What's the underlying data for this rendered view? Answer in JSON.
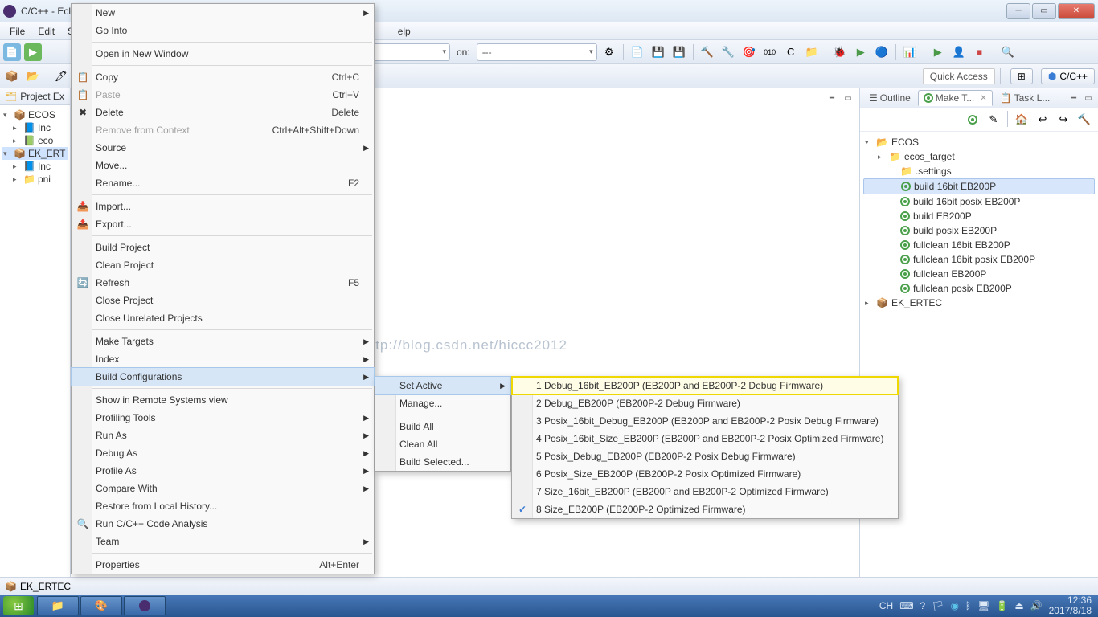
{
  "titlebar": {
    "title": "C/C++ - Ecl"
  },
  "menubar": {
    "items": [
      "File",
      "Edit",
      "So",
      "elp"
    ]
  },
  "toolbar1": {
    "on_label": "on:",
    "on_value": "---"
  },
  "toolbar2": {
    "quick_access": "Quick Access",
    "perspective": "C/C++"
  },
  "project_explorer": {
    "title": "Project Ex",
    "tree": [
      {
        "label": "ECOS",
        "expanded": true,
        "icon": "project"
      },
      {
        "label": "Inc",
        "indent": 1,
        "icon": "h"
      },
      {
        "label": "eco",
        "indent": 1,
        "icon": "c"
      },
      {
        "label": "EK_ERT",
        "expanded": true,
        "icon": "project",
        "selected": true
      },
      {
        "label": "Inc",
        "indent": 1,
        "icon": "h"
      },
      {
        "label": "pni",
        "indent": 1,
        "icon": "folder"
      }
    ]
  },
  "context_menu": {
    "groups": [
      [
        {
          "label": "New",
          "arrow": true
        },
        {
          "label": "Go Into"
        }
      ],
      [
        {
          "label": "Open in New Window"
        }
      ],
      [
        {
          "label": "Copy",
          "shortcut": "Ctrl+C",
          "icon": "copy"
        },
        {
          "label": "Paste",
          "shortcut": "Ctrl+V",
          "icon": "paste",
          "disabled": true
        },
        {
          "label": "Delete",
          "shortcut": "Delete",
          "icon": "delete"
        },
        {
          "label": "Remove from Context",
          "shortcut": "Ctrl+Alt+Shift+Down",
          "disabled": true
        },
        {
          "label": "Source",
          "arrow": true
        },
        {
          "label": "Move..."
        },
        {
          "label": "Rename...",
          "shortcut": "F2"
        }
      ],
      [
        {
          "label": "Import...",
          "icon": "import"
        },
        {
          "label": "Export...",
          "icon": "export"
        }
      ],
      [
        {
          "label": "Build Project"
        },
        {
          "label": "Clean Project"
        },
        {
          "label": "Refresh",
          "shortcut": "F5",
          "icon": "refresh"
        },
        {
          "label": "Close Project"
        },
        {
          "label": "Close Unrelated Projects"
        }
      ],
      [
        {
          "label": "Make Targets",
          "arrow": true
        },
        {
          "label": "Index",
          "arrow": true
        },
        {
          "label": "Build Configurations",
          "arrow": true,
          "hover": true
        }
      ],
      [
        {
          "label": "Show in Remote Systems view"
        },
        {
          "label": "Profiling Tools",
          "arrow": true
        },
        {
          "label": "Run As",
          "arrow": true
        },
        {
          "label": "Debug As",
          "arrow": true
        },
        {
          "label": "Profile As",
          "arrow": true
        },
        {
          "label": "Compare With",
          "arrow": true
        },
        {
          "label": "Restore from Local History..."
        },
        {
          "label": "Run C/C++ Code Analysis",
          "icon": "analysis"
        },
        {
          "label": "Team",
          "arrow": true
        }
      ],
      [
        {
          "label": "Properties",
          "shortcut": "Alt+Enter"
        }
      ]
    ]
  },
  "submenu1": {
    "groups": [
      [
        {
          "label": "Set Active",
          "arrow": true,
          "hover": true
        },
        {
          "label": "Manage..."
        }
      ],
      [
        {
          "label": "Build All"
        },
        {
          "label": "Clean All"
        },
        {
          "label": "Build Selected..."
        }
      ]
    ]
  },
  "submenu2": {
    "items": [
      {
        "label": "1 Debug_16bit_EB200P (EB200P and EB200P-2 Debug Firmware)",
        "highlighted": true
      },
      {
        "label": "2 Debug_EB200P (EB200P-2 Debug Firmware)"
      },
      {
        "label": "3 Posix_16bit_Debug_EB200P (EB200P and EB200P-2 Posix Debug Firmware)"
      },
      {
        "label": "4 Posix_16bit_Size_EB200P (EB200P and EB200P-2 Posix Optimized Firmware)"
      },
      {
        "label": "5 Posix_Debug_EB200P (EB200P-2 Posix Debug Firmware)"
      },
      {
        "label": "6 Posix_Size_EB200P (EB200P-2 Posix Optimized Firmware)"
      },
      {
        "label": "7 Size_16bit_EB200P (EB200P and EB200P-2 Optimized Firmware)"
      },
      {
        "label": "8 Size_EB200P (EB200P-2 Optimized Firmware)",
        "checked": true
      }
    ]
  },
  "watermark": "http://blog.csdn.net/hiccc2012",
  "outline": {
    "tabs": [
      "Outline",
      "Make T...",
      "Task L..."
    ],
    "active_tab": 1,
    "tree": [
      {
        "label": "ECOS",
        "icon": "folder-open",
        "expanded": true
      },
      {
        "label": "ecos_target",
        "indent": 1,
        "icon": "folder",
        "expandable": true
      },
      {
        "label": ".settings",
        "indent": 1,
        "icon": "folder"
      },
      {
        "label": "build 16bit EB200P",
        "indent": 1,
        "icon": "target",
        "selected": true
      },
      {
        "label": "build 16bit posix EB200P",
        "indent": 1,
        "icon": "target"
      },
      {
        "label": "build EB200P",
        "indent": 1,
        "icon": "target"
      },
      {
        "label": "build posix EB200P",
        "indent": 1,
        "icon": "target"
      },
      {
        "label": "fullclean 16bit EB200P",
        "indent": 1,
        "icon": "target"
      },
      {
        "label": "fullclean 16bit posix EB200P",
        "indent": 1,
        "icon": "target"
      },
      {
        "label": "fullclean EB200P",
        "indent": 1,
        "icon": "target"
      },
      {
        "label": "fullclean posix EB200P",
        "indent": 1,
        "icon": "target"
      },
      {
        "label": "EK_ERTEC",
        "icon": "project",
        "expandable": true
      }
    ]
  },
  "statusbar": {
    "item": "EK_ERTEC"
  },
  "taskbar": {
    "input_lang": "CH",
    "time": "12:36",
    "date": "2017/8/18"
  }
}
